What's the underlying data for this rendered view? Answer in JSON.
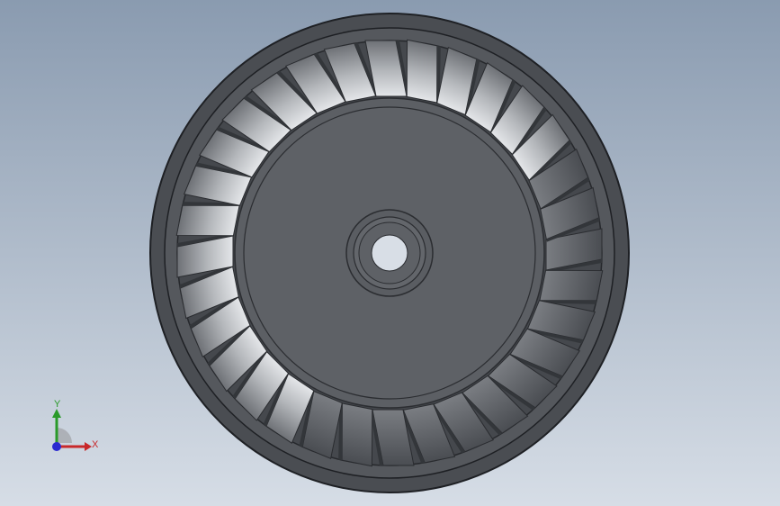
{
  "viewport": {
    "background_top": "#8a9bb0",
    "background_bottom": "#d6dde6"
  },
  "model": {
    "name_icon": "turbine-wheel-model",
    "blade_count": 32,
    "colors": {
      "outer_ring": "#4a4d52",
      "outer_ring_edge": "#2a2c30",
      "shroud_inner": "#5a5d62",
      "blade_light": "#c9cbcf",
      "blade_mid": "#9a9da2",
      "blade_dark": "#55585d",
      "hub": "#5c5f64",
      "hub_edge": "#2b2d31",
      "bore": "#d8dee6"
    }
  },
  "triad": {
    "x_label": "X",
    "y_label": "Y",
    "x_color": "#c8282a",
    "y_color": "#2a9a2a",
    "z_color": "#2a2ad0"
  }
}
